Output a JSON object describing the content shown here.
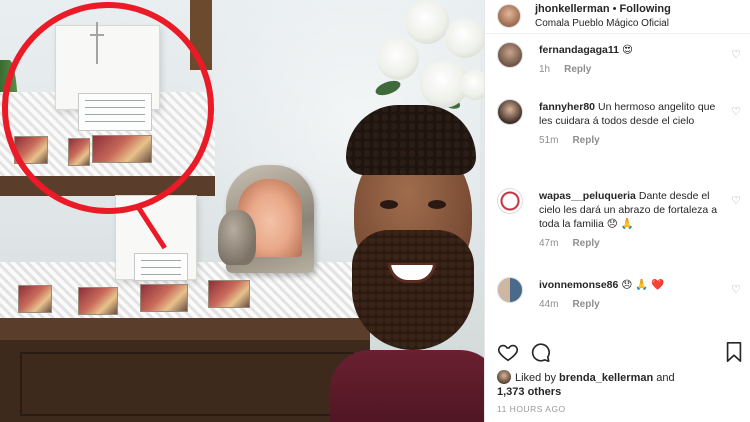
{
  "post": {
    "username": "jhonkellerman",
    "separator": " • ",
    "follow_label": "Following",
    "location": "Comala Pueblo Mágico Oficial"
  },
  "comments": [
    {
      "username": "fernandagaga11",
      "text": "😍",
      "time": "1h",
      "reply_label": "Reply"
    },
    {
      "username": "fannyher80",
      "text": "Un hermoso angelito que les cuidara á todos desde el cielo",
      "time": "51m",
      "reply_label": "Reply"
    },
    {
      "username": "wapas__peluqueria",
      "text": "Dante desde el cielo les dará un abrazo de fortaleza a toda la familia 😞 🙏",
      "time": "47m",
      "reply_label": "Reply"
    },
    {
      "username": "ivonnemonse86",
      "text": "😞 🙏 ❤️",
      "time": "44m",
      "reply_label": "Reply"
    }
  ],
  "likes": {
    "prefix": "Liked by ",
    "user": "brenda_kellerman",
    "middle": " and",
    "count_text": "1,373 others"
  },
  "timestamp": "11 HOURS AGO",
  "icons": {
    "comment_heart": "♡",
    "like": "heart-outline-icon",
    "comment": "speech-bubble-icon",
    "save": "bookmark-icon"
  },
  "colors": {
    "annotation_red": "#ea1a26",
    "like_heart_red": "#ed4956"
  }
}
